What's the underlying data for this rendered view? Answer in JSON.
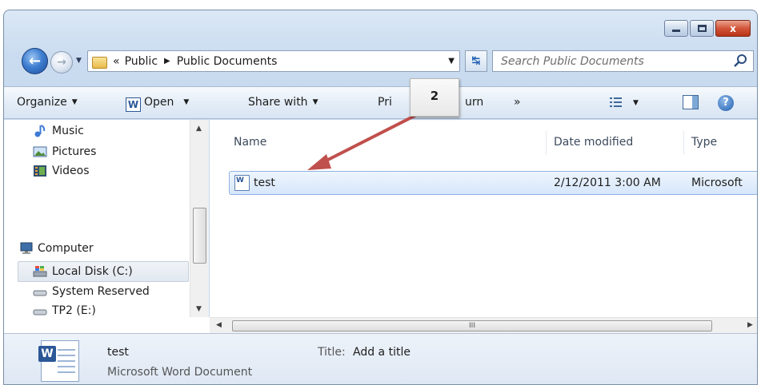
{
  "window": {
    "caption": {
      "minimize": "minimize",
      "maximize": "maximize",
      "close": "x"
    }
  },
  "address": {
    "overflow": "«",
    "crumbs": [
      "Public",
      "Public Documents"
    ]
  },
  "search": {
    "placeholder": "Search Public Documents"
  },
  "toolbar": {
    "organize": "Organize",
    "open": "Open",
    "open_badge": "W",
    "share_with": "Share with",
    "print": "Pri",
    "burn": "urn",
    "more": "»"
  },
  "navpane": {
    "items": [
      {
        "label": "Music",
        "icon": "music-icon"
      },
      {
        "label": "Pictures",
        "icon": "pictures-icon"
      },
      {
        "label": "Videos",
        "icon": "videos-icon"
      },
      {
        "label": "Computer",
        "icon": "computer-icon"
      },
      {
        "label": "Local Disk (C:)",
        "icon": "local-disk-icon"
      },
      {
        "label": "System Reserved",
        "icon": "drive-icon"
      },
      {
        "label": "TP2 (E:)",
        "icon": "drive-icon"
      }
    ]
  },
  "columns": {
    "name": "Name",
    "date": "Date modified",
    "type": "Type"
  },
  "files": [
    {
      "name": "test",
      "date": "2/12/2011 3:00 AM",
      "type": "Microsoft"
    }
  ],
  "details": {
    "name": "test",
    "type": "Microsoft Word Document",
    "title_label": "Title:",
    "title_value": "Add a title",
    "icon_badge": "W"
  },
  "callout": {
    "label": "2"
  },
  "scrollbar": {
    "grip": "III"
  },
  "colors": {
    "callout_arrow": "#c0504d",
    "selection": "#d6e7fb",
    "close_button": "#c8412a"
  }
}
